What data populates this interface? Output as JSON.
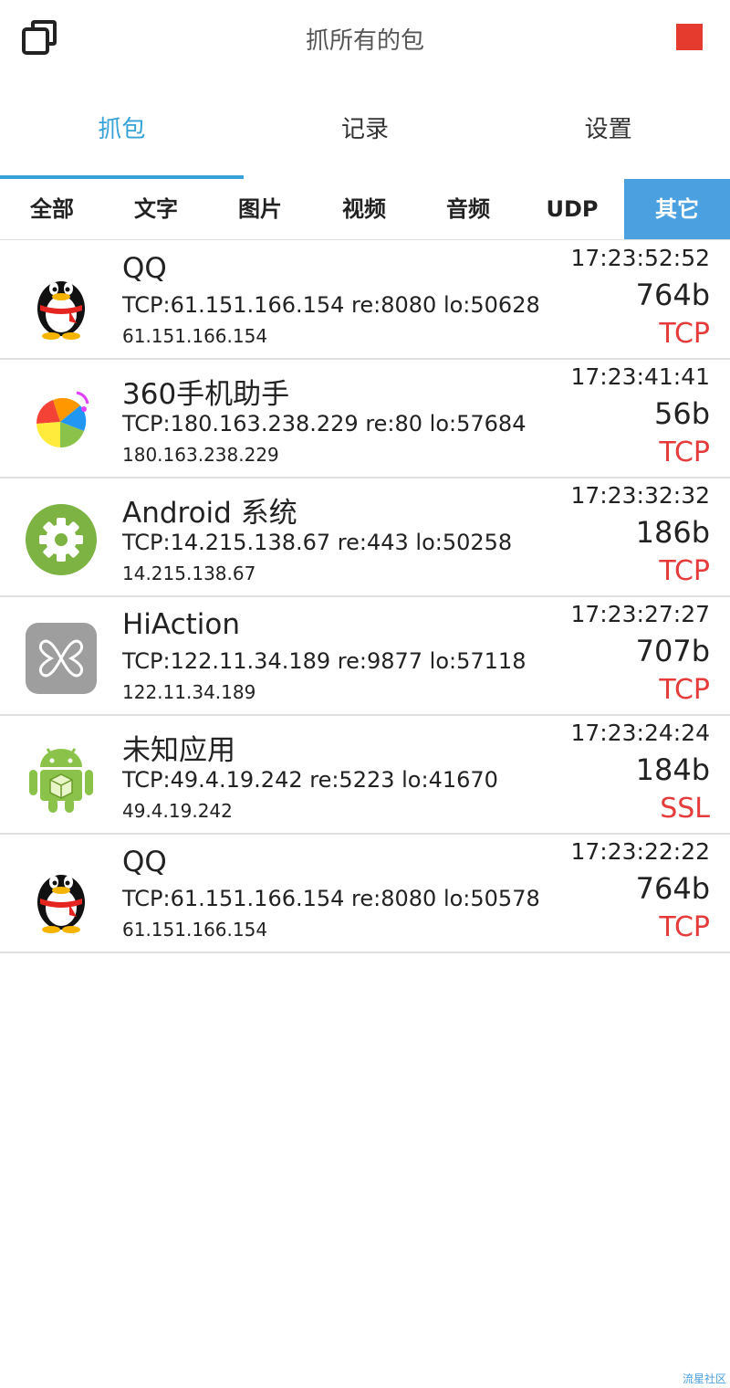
{
  "header": {
    "title": "抓所有的包"
  },
  "main_tabs": [
    {
      "label": "抓包",
      "active": true
    },
    {
      "label": "记录",
      "active": false
    },
    {
      "label": "设置",
      "active": false
    }
  ],
  "filters": [
    {
      "label": "全部",
      "active": false
    },
    {
      "label": "文字",
      "active": false
    },
    {
      "label": "图片",
      "active": false
    },
    {
      "label": "视频",
      "active": false
    },
    {
      "label": "音频",
      "active": false
    },
    {
      "label": "UDP",
      "active": false
    },
    {
      "label": "其它",
      "active": true
    }
  ],
  "packets": [
    {
      "app": "QQ",
      "icon": "qq-penguin-icon",
      "conn": "TCP:61.151.166.154 re:8080 lo:50628",
      "ip": "61.151.166.154",
      "time": "17:23:52:52",
      "size": "764b",
      "protocol": "TCP"
    },
    {
      "app": "360手机助手",
      "icon": "360-assistant-icon",
      "conn": "TCP:180.163.238.229 re:80 lo:57684",
      "ip": "180.163.238.229",
      "time": "17:23:41:41",
      "size": "56b",
      "protocol": "TCP"
    },
    {
      "app": "Android 系统",
      "icon": "android-settings-gear-icon",
      "conn": "TCP:14.215.138.67 re:443 lo:50258",
      "ip": "14.215.138.67",
      "time": "17:23:32:32",
      "size": "186b",
      "protocol": "TCP"
    },
    {
      "app": "HiAction",
      "icon": "hiaction-butterfly-icon",
      "conn": "TCP:122.11.34.189 re:9877 lo:57118",
      "ip": "122.11.34.189",
      "time": "17:23:27:27",
      "size": "707b",
      "protocol": "TCP"
    },
    {
      "app": "未知应用",
      "icon": "android-robot-icon",
      "conn": "TCP:49.4.19.242 re:5223 lo:41670",
      "ip": "49.4.19.242",
      "time": "17:23:24:24",
      "size": "184b",
      "protocol": "SSL"
    },
    {
      "app": "QQ",
      "icon": "qq-penguin-icon",
      "conn": "TCP:61.151.166.154 re:8080 lo:50578",
      "ip": "61.151.166.154",
      "time": "17:23:22:22",
      "size": "764b",
      "protocol": "TCP"
    }
  ],
  "watermark": "流星社区",
  "colors": {
    "accent": "#36a2d8",
    "filter_active": "#4ba0e0",
    "protocol": "#e53b3b",
    "stop": "#e53b2f"
  }
}
